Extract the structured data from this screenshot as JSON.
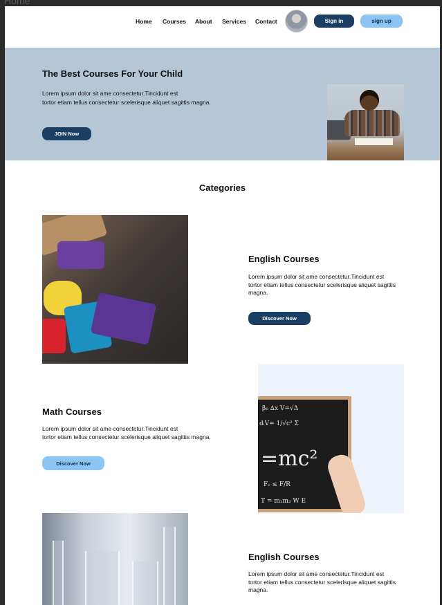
{
  "frame_label": "Home",
  "nav": {
    "links": [
      "Home",
      "Courses",
      "About",
      "Services",
      "Contact"
    ],
    "sign_in": "Sign in",
    "sign_up": "sign up"
  },
  "hero": {
    "title": "The Best Courses For Your Child",
    "text_line1": "Lorem ipsum dolor sit ame  consectetur.Tincidunt est",
    "text_line2": "tortor etiam tellus consectetur scelerisque aliquet sagittis magna.",
    "cta": "JOIN Now"
  },
  "categories": {
    "title": "Categories",
    "items": [
      {
        "title": "English Courses",
        "text": "Lorem ipsum dolor sit ame  consectetur.Tincidunt est\ntortor etiam tellus consectetur scelerisque aliquet sagittis magna.",
        "button": "Discover Now"
      },
      {
        "title": "Math Courses",
        "text": "Lorem ipsum dolor sit ame  consectetur.Tincidunt est\ntortor etiam tellus consectetur scelerisque aliquet sagittis magna.",
        "button": "Discover Now"
      },
      {
        "title": "English Courses",
        "text": "Lorem ipsum dolor sit ame  consectetur.Tincidunt est\ntortor etiam tellus consectetur scelerisque aliquet sagittis magna."
      }
    ]
  },
  "colors": {
    "primary_dark": "#1b3f63",
    "primary_light": "#8cc5f3",
    "hero_bg": "#b4c5d6"
  }
}
